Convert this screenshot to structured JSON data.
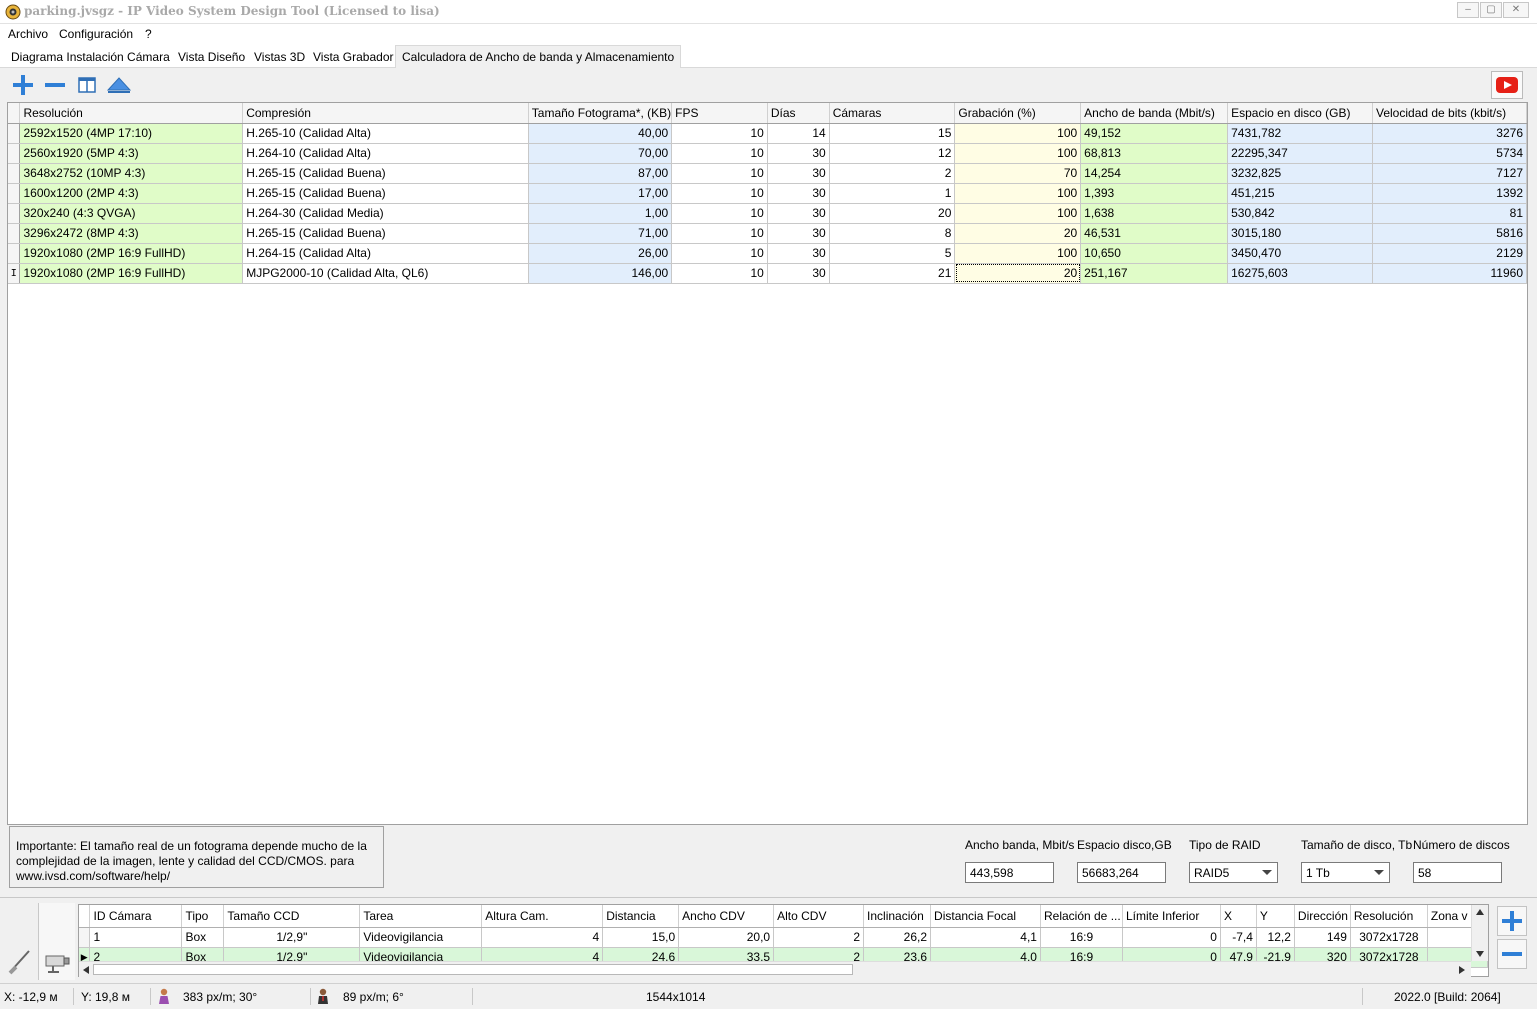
{
  "window": {
    "title": "parking.jvsgz - IP Video System Design Tool (Licensed to lisa)",
    "controls": [
      "–",
      "▢",
      "✕"
    ]
  },
  "menu": [
    "Archivo",
    "Configuración",
    "?"
  ],
  "tabs": [
    {
      "label": "Diagrama Instalación Cámara",
      "active": false
    },
    {
      "label": "Vista Diseño",
      "active": false
    },
    {
      "label": "Vistas 3D",
      "active": false
    },
    {
      "label": "Vista Grabador",
      "active": false
    },
    {
      "label": "Calculadora de Ancho de banda y Almacenamiento",
      "active": true
    }
  ],
  "toolbar": {
    "icons": [
      "add-icon",
      "remove-icon",
      "columns-icon",
      "collapse-up-icon",
      "youtube-icon"
    ]
  },
  "grid": {
    "columns": [
      "Resolución",
      "Compresión",
      "Tamaño Fotograma*, (KB)",
      "FPS",
      "Días",
      "Cámaras",
      "Grabación (%)",
      "Ancho de banda (Mbit/s)",
      "Espacio en disco (GB)",
      "Velocidad de bits (kbit/s)"
    ],
    "rows": [
      [
        "2592x1520 (4MP 17:10)",
        "H.265-10 (Calidad Alta)",
        "40,00",
        "10",
        "14",
        "15",
        "100",
        "49,152",
        "7431,782",
        "3276"
      ],
      [
        "2560x1920 (5MP 4:3)",
        "H.264-10 (Calidad Alta)",
        "70,00",
        "10",
        "30",
        "12",
        "100",
        "68,813",
        "22295,347",
        "5734"
      ],
      [
        "3648x2752 (10MP 4:3)",
        "H.265-15 (Calidad Buena)",
        "87,00",
        "10",
        "30",
        "2",
        "70",
        "14,254",
        "3232,825",
        "7127"
      ],
      [
        "1600x1200 (2MP 4:3)",
        "H.265-15 (Calidad Buena)",
        "17,00",
        "10",
        "30",
        "1",
        "100",
        "1,393",
        "451,215",
        "1392"
      ],
      [
        "320x240 (4:3 QVGA)",
        "H.264-30 (Calidad Media)",
        "1,00",
        "10",
        "30",
        "20",
        "100",
        "1,638",
        "530,842",
        "81"
      ],
      [
        "3296x2472 (8MP 4:3)",
        "H.265-15 (Calidad Buena)",
        "71,00",
        "10",
        "30",
        "8",
        "20",
        "46,531",
        "3015,180",
        "5816"
      ],
      [
        "1920x1080 (2MP 16:9 FullHD)",
        "H.264-15 (Calidad Alta)",
        "26,00",
        "10",
        "30",
        "5",
        "100",
        "10,650",
        "3450,470",
        "2129"
      ],
      [
        "1920x1080 (2MP 16:9 FullHD)",
        "MJPG2000-10 (Calidad Alta, QL6)",
        "146,00",
        "10",
        "30",
        "21",
        "20",
        "251,167",
        "16275,603",
        "11960"
      ]
    ],
    "current_row_marker": "I"
  },
  "note": {
    "text": "Importante: El tamaño real de un fotograma depende mucho de la complejidad de la imagen, lente y calidad del CCD/CMOS. para www.ivsd.com/software/help/"
  },
  "summary": {
    "bandwidth_label": "Ancho banda, Mbit/s",
    "bandwidth_value": "443,598",
    "disk_label": "Espacio disco,GB",
    "disk_value": "56683,264",
    "raid_label": "Tipo de RAID",
    "raid_value": "RAID5",
    "disk_size_label": "Tamaño de disco, Tb",
    "disk_size_value": "1 Tb",
    "disk_count_label": "Número de discos",
    "disk_count_value": "58"
  },
  "cameras": {
    "columns": [
      "ID Cámara",
      "Tipo",
      "Tamaño CCD",
      "Tarea",
      "Altura Cam.",
      "Distancia",
      "Ancho CDV",
      "Alto CDV",
      "Inclinación",
      "Distancia Focal",
      "Relación de ...",
      "Límite Inferior",
      "X",
      "Y",
      "Dirección",
      "Resolución",
      "Zona v"
    ],
    "rows": [
      [
        "1",
        "Box",
        "1/2,9\"",
        "Videovigilancia",
        "4",
        "15,0",
        "20,0",
        "2",
        "26,2",
        "4,1",
        "16:9",
        "0",
        "-7,4",
        "12,2",
        "149",
        "3072x1728",
        ""
      ],
      [
        "2",
        "Box",
        "1/2,9\"",
        "Videovigilancia",
        "4",
        "24,6",
        "33,5",
        "2",
        "23,6",
        "4,0",
        "16:9",
        "0",
        "47,9",
        "-21,9",
        "320",
        "3072x1728",
        ""
      ]
    ]
  },
  "status": {
    "x": "X: -12,9 м",
    "y": "Y: 19,8 м",
    "density1": "383 px/m; 30°",
    "density2": "89 px/m; 6°",
    "size": "1544x1014",
    "version": "2022.0 [Build: 2064]"
  },
  "colors": {
    "green_cell": "#e0fcc8",
    "blue_cell": "#e2eefc",
    "yellow_cell": "#fffde4",
    "accent_blue": "#2f7fd6",
    "youtube_red": "#e62117"
  }
}
